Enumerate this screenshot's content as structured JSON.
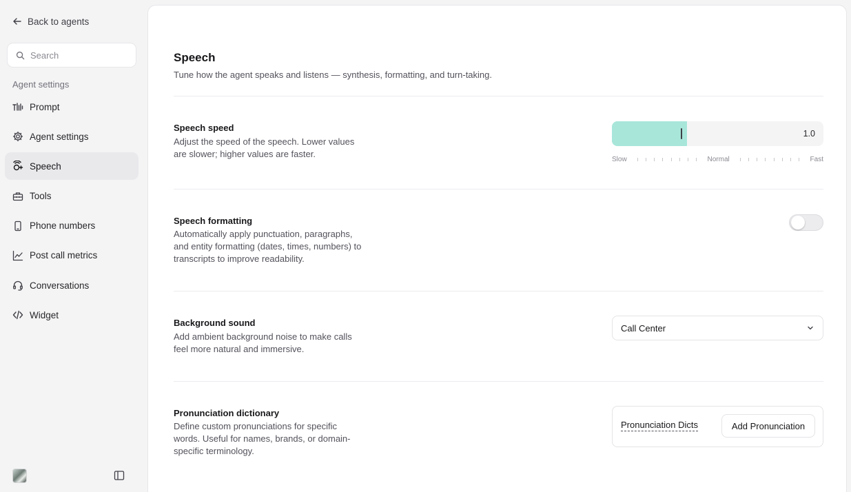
{
  "sidebar": {
    "back_label": "Back to agents",
    "search_placeholder": "Search",
    "section_label": "Agent settings",
    "items": [
      {
        "label": "Prompt",
        "icon": "waveform-icon"
      },
      {
        "label": "Agent settings",
        "icon": "gear-icon"
      },
      {
        "label": "Speech",
        "icon": "speech-icon",
        "active": true
      },
      {
        "label": "Tools",
        "icon": "toolbox-icon"
      },
      {
        "label": "Phone numbers",
        "icon": "phone-icon"
      },
      {
        "label": "Post call metrics",
        "icon": "chart-line-icon"
      },
      {
        "label": "Conversations",
        "icon": "headset-icon"
      },
      {
        "label": "Widget",
        "icon": "code-icon"
      }
    ]
  },
  "page": {
    "title": "Speech",
    "subtitle": "Tune how the agent speaks and listens — synthesis, formatting, and turn-taking."
  },
  "speech_speed": {
    "title": "Speech speed",
    "description": "Adjust the speed of the speech. Lower values are slower; higher values are faster.",
    "value": "1.0",
    "fill_fraction": 0.355,
    "scale_slow": "Slow",
    "scale_normal": "Normal",
    "scale_fast": "Fast"
  },
  "speech_formatting": {
    "title": "Speech formatting",
    "description": "Automatically apply punctuation, paragraphs, and entity formatting (dates, times, numbers) to transcripts to improve readability.",
    "enabled": false
  },
  "background_sound": {
    "title": "Background sound",
    "description": "Add ambient background noise to make calls feel more natural and immersive.",
    "selected": "Call Center"
  },
  "pronunciation": {
    "title": "Pronunciation dictionary",
    "description": "Define custom pronunciations for specific words. Useful for names, brands, or domain-specific terminology.",
    "tab_label": "Pronunciation Dicts",
    "button_label": "Add Pronunciation"
  },
  "colors": {
    "accent_fill": "#a8e6da",
    "active_nav": "#e9e9ec"
  }
}
